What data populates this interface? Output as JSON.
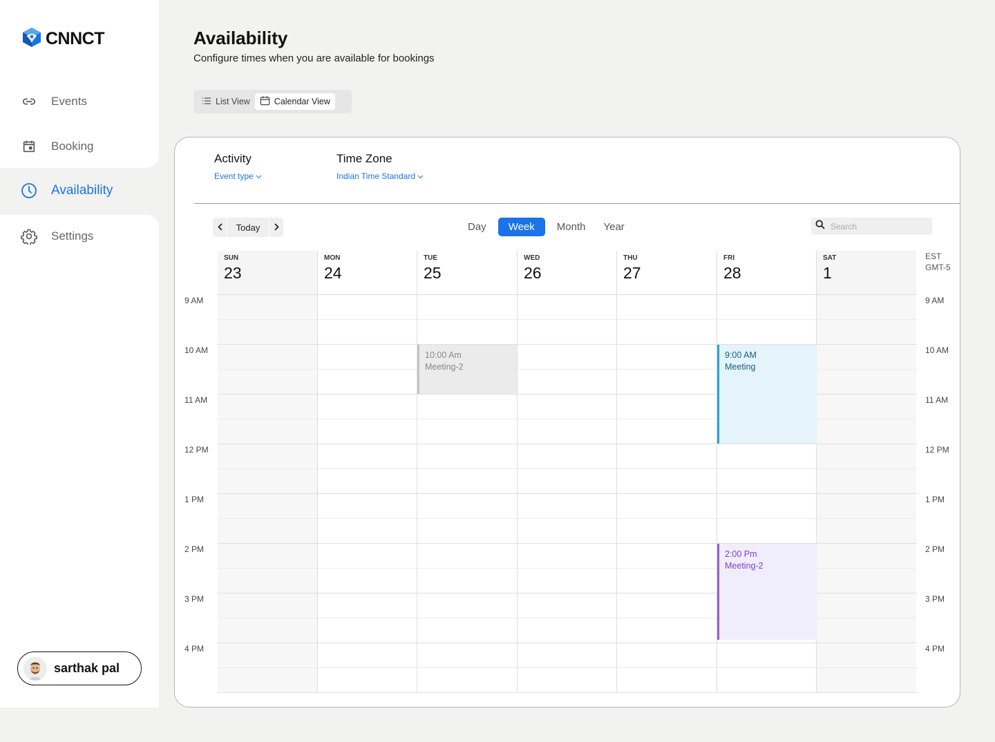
{
  "brand": {
    "name": "CNNCT"
  },
  "sidebar": {
    "items": [
      {
        "label": "Events",
        "icon": "link-icon"
      },
      {
        "label": "Booking",
        "icon": "calendar-icon"
      },
      {
        "label": "Availability",
        "icon": "clock-icon",
        "active": true
      },
      {
        "label": "Settings",
        "icon": "gear-icon"
      }
    ],
    "user": {
      "name": "sarthak pal"
    }
  },
  "header": {
    "title": "Availability",
    "subtitle": "Configure times when you are available for bookings"
  },
  "view_toggle": {
    "list": "List View",
    "calendar": "Calendar View",
    "selected": "calendar"
  },
  "filters": {
    "activity": {
      "title": "Activity",
      "value": "Event type"
    },
    "timezone": {
      "title": "Time Zone",
      "value": "Indian Time Standard"
    }
  },
  "toolbar": {
    "today": "Today",
    "ranges": [
      "Day",
      "Week",
      "Month",
      "Year"
    ],
    "active_range": "Week",
    "search_placeholder": "Search"
  },
  "calendar": {
    "tz_line1": "EST",
    "tz_line2": "GMT-5",
    "days": [
      {
        "dow": "SUN",
        "num": "23"
      },
      {
        "dow": "MON",
        "num": "24"
      },
      {
        "dow": "TUE",
        "num": "25"
      },
      {
        "dow": "WED",
        "num": "26"
      },
      {
        "dow": "THU",
        "num": "27"
      },
      {
        "dow": "FRI",
        "num": "28"
      },
      {
        "dow": "SAT",
        "num": "1"
      }
    ],
    "hours": [
      "9 AM",
      "10 AM",
      "11 AM",
      "12 PM",
      "1 PM",
      "2 PM",
      "3 PM",
      "4 PM"
    ],
    "events": [
      {
        "time": "10:00 Am",
        "title": "Meeting-2",
        "day": "TUE",
        "color": "#c3c3c3"
      },
      {
        "time": "9:00 AM",
        "title": "Meeting",
        "day": "FRI",
        "color": "#1fa3de"
      },
      {
        "time": "2:00 Pm",
        "title": "Meeting-2",
        "day": "FRI",
        "color": "#8d5ee0"
      }
    ]
  },
  "colors": {
    "accent": "#1a73e8"
  }
}
